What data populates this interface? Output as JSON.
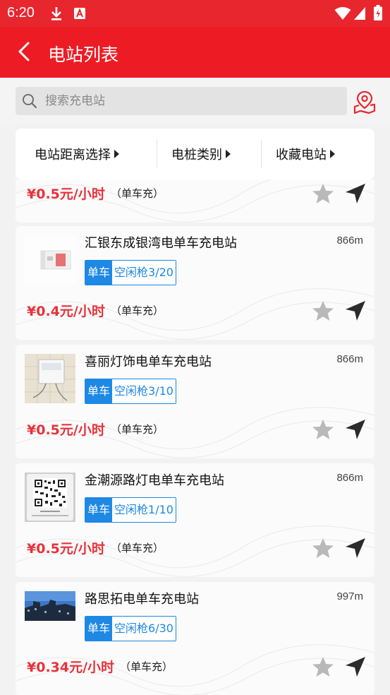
{
  "status_bar": {
    "time": "6:20"
  },
  "app_bar": {
    "title": "电站列表"
  },
  "search": {
    "placeholder": "搜索充电站"
  },
  "filters": [
    {
      "label": "电站距离选择"
    },
    {
      "label": "电桩类别"
    },
    {
      "label": "收藏电站"
    }
  ],
  "partial_card": {
    "price": "¥0.5元/小时",
    "type_label": "（单车充）"
  },
  "stations": [
    {
      "name": "汇银东成银湾电单车充电站",
      "distance": "866m",
      "tag_type": "单车",
      "free_guns": "空闲枪3/20",
      "price": "¥0.4元/小时",
      "type_label": "（单车充）"
    },
    {
      "name": "喜丽灯饰电单车充电站",
      "distance": "866m",
      "tag_type": "单车",
      "free_guns": "空闲枪3/10",
      "price": "¥0.5元/小时",
      "type_label": "（单车充）"
    },
    {
      "name": "金潮源路灯电单车充电站",
      "distance": "866m",
      "tag_type": "单车",
      "free_guns": "空闲枪1/10",
      "price": "¥0.5元/小时",
      "type_label": "（单车充）"
    },
    {
      "name": "路思拓电单车充电站",
      "distance": "997m",
      "tag_type": "单车",
      "free_guns": "空闲枪6/30",
      "price": "¥0.34元/小时",
      "type_label": "（单车充）"
    }
  ],
  "colors": {
    "primary": "#ed1c24",
    "tag_blue": "#1e88e5",
    "price_red": "#e8323a"
  },
  "icons": [
    "download-icon",
    "notification-a-icon",
    "wifi-icon",
    "signal-icon",
    "battery-icon",
    "back-arrow-icon",
    "search-icon",
    "map-location-icon",
    "star-icon",
    "navigate-icon",
    "caret-right-icon"
  ]
}
